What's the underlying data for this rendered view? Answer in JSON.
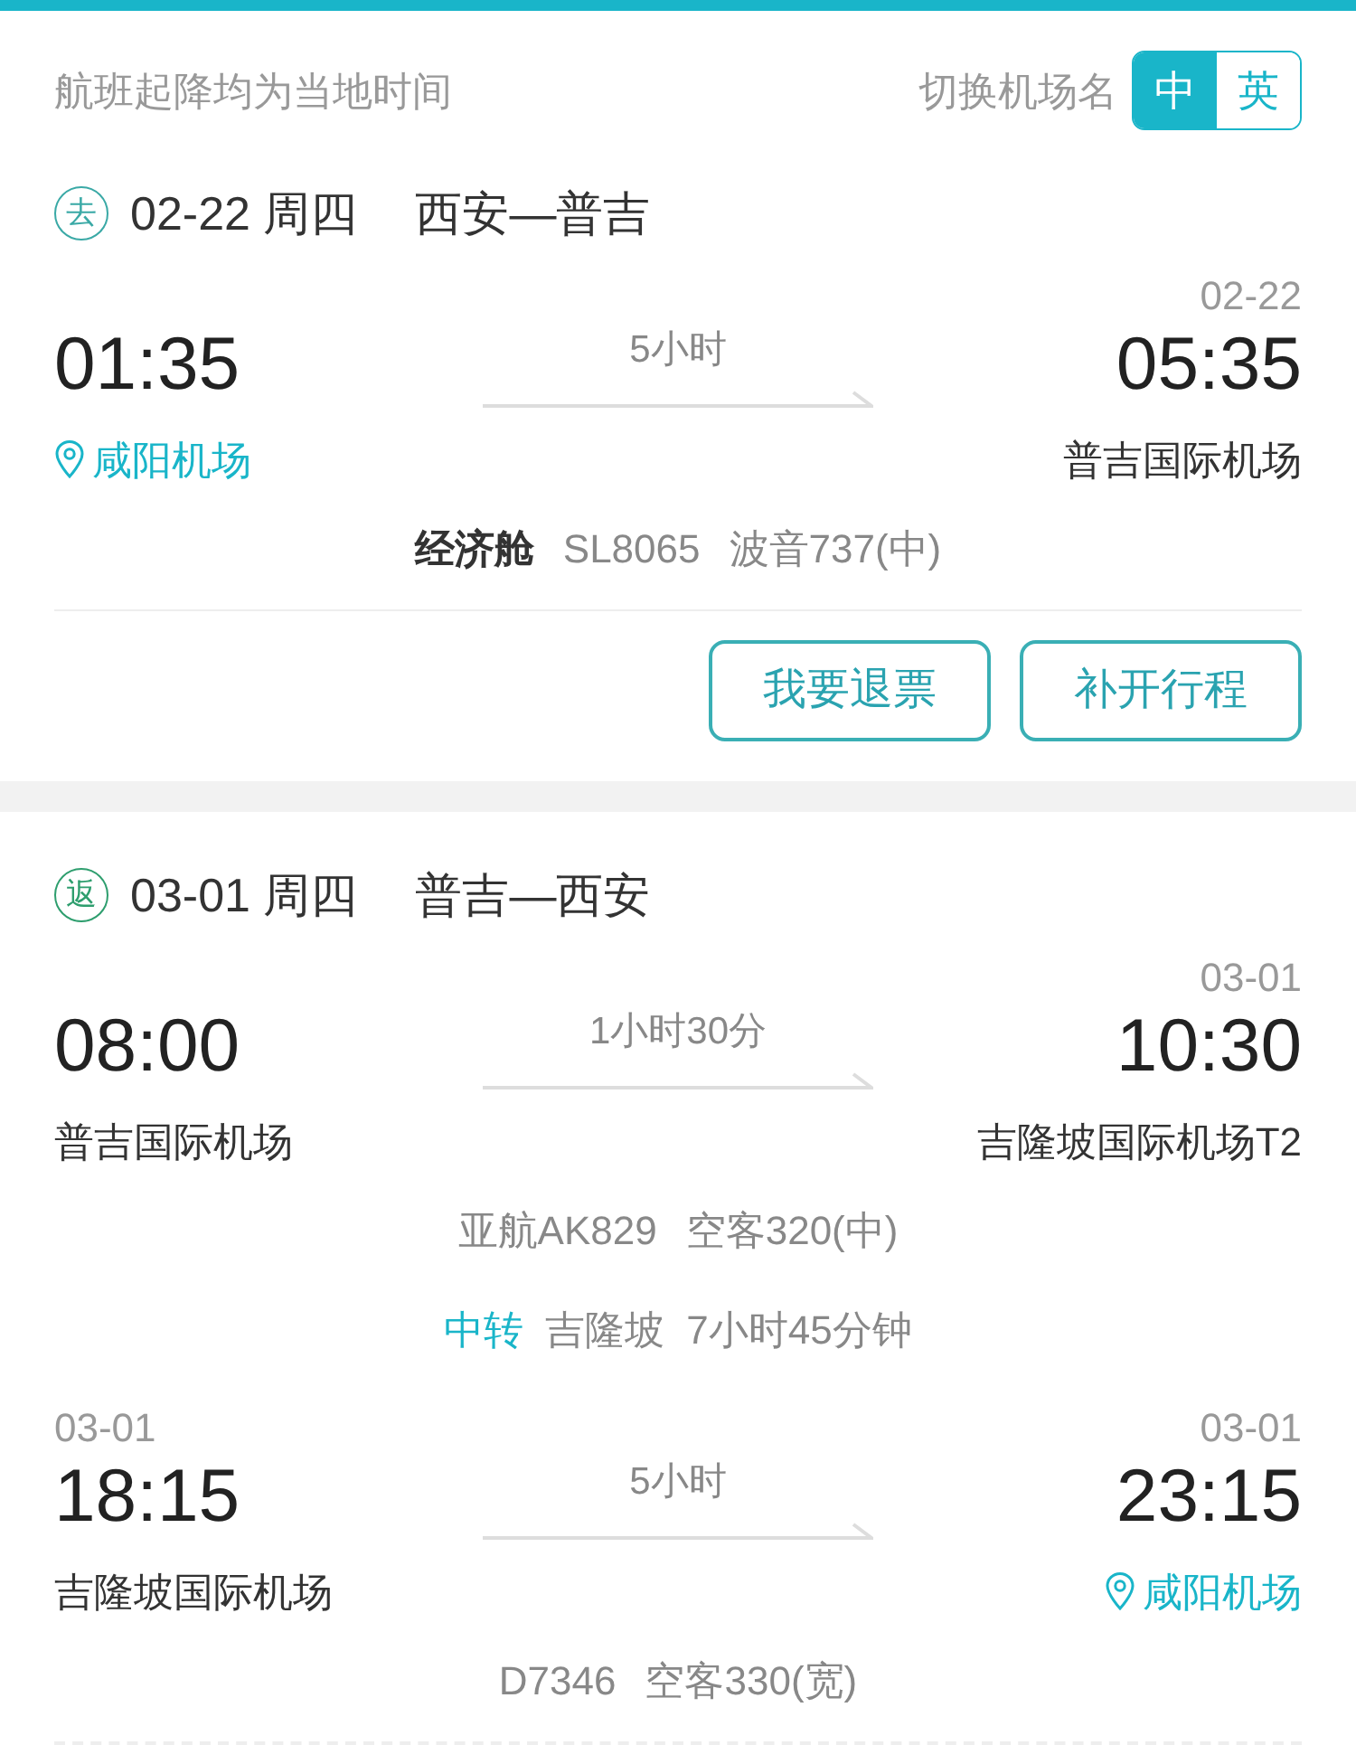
{
  "notice": "航班起降均为当地时间",
  "name_switch": {
    "label": "切换机场名",
    "options": [
      {
        "label": "中",
        "selected": true
      },
      {
        "label": "英",
        "selected": false
      }
    ]
  },
  "trips": [
    {
      "badge": "去",
      "color": "#3aa9a6",
      "date": "02-22 周四",
      "route": "西安—普吉",
      "segments": [
        {
          "dep_time": "01:35",
          "duration": "5小时",
          "arr_date": "02-22",
          "arr_time": "05:35",
          "dep_airport": {
            "name": "咸阳机场",
            "home": true
          },
          "arr_airport": {
            "name": "普吉国际机场",
            "home": false
          },
          "info": [
            {
              "text": "经济舱",
              "kind": "cabin"
            },
            {
              "text": "SL8065",
              "kind": "detail"
            },
            {
              "text": "波音737(中)",
              "kind": "detail"
            }
          ]
        }
      ],
      "buttons": [
        "我要退票",
        "补开行程"
      ]
    },
    {
      "badge": "返",
      "color": "#2e9e6e",
      "date": "03-01 周四",
      "route": "普吉—西安",
      "segments": [
        {
          "dep_time": "08:00",
          "duration": "1小时30分",
          "arr_date": "03-01",
          "arr_time": "10:30",
          "dep_airport": {
            "name": "普吉国际机场",
            "home": false
          },
          "arr_airport": {
            "name": "吉隆坡国际机场T2",
            "home": false
          },
          "info": [
            {
              "text": "亚航AK829",
              "kind": "detail"
            },
            {
              "text": "空客320(中)",
              "kind": "detail"
            }
          ],
          "transfer": {
            "label": "中转",
            "city": "吉隆坡",
            "duration": "7小时45分钟"
          }
        },
        {
          "dep_date": "03-01",
          "dep_time": "18:15",
          "duration": "5小时",
          "arr_date": "03-01",
          "arr_time": "23:15",
          "dep_airport": {
            "name": "吉隆坡国际机场",
            "home": false
          },
          "arr_airport": {
            "name": "咸阳机场",
            "home": true
          },
          "info": [
            {
              "text": "D7346",
              "kind": "detail"
            },
            {
              "text": "空客330(宽)",
              "kind": "detail"
            }
          ]
        }
      ]
    }
  ]
}
